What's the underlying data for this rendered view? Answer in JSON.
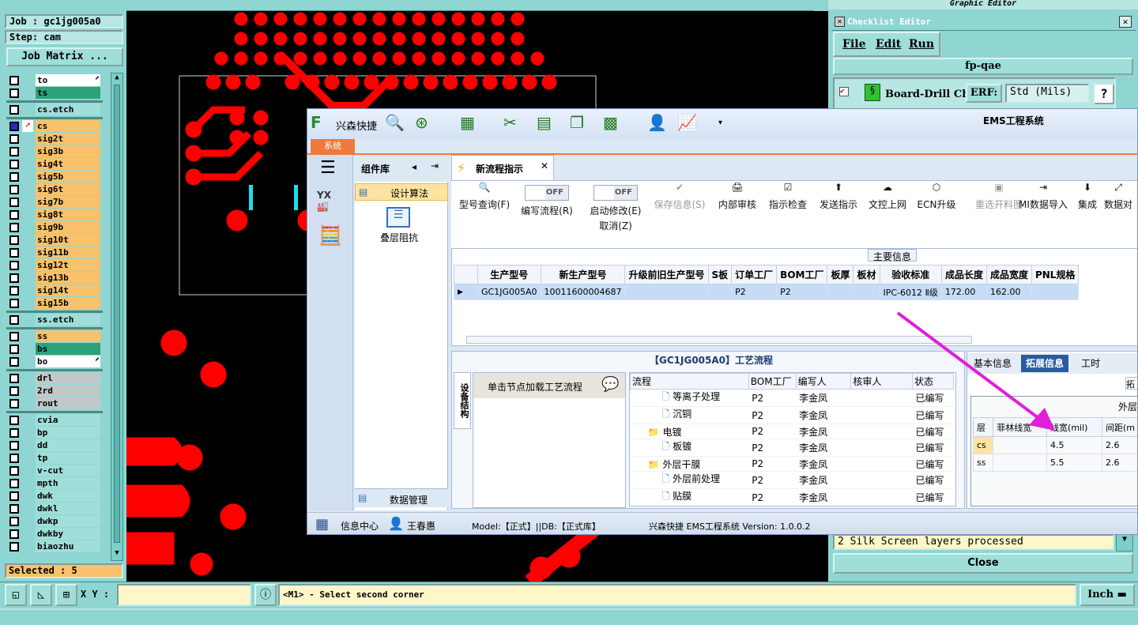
{
  "left_panel": {
    "job": "Job : gc1jg005a0",
    "step": "Step: cam",
    "job_matrix": "Job Matrix ...",
    "selected": "Selected : 5",
    "layers": [
      {
        "name": "to",
        "color": "#ffffff",
        "flag": "⬈"
      },
      {
        "name": "ts",
        "color": "#2aa27a"
      },
      {
        "name": "cs.etch",
        "color": "#9fded9"
      },
      {
        "name": "cs",
        "color": "#f7c26b",
        "active": true
      },
      {
        "name": "sig2t",
        "color": "#f7c26b"
      },
      {
        "name": "sig3b",
        "color": "#f7c26b"
      },
      {
        "name": "sig4t",
        "color": "#f7c26b"
      },
      {
        "name": "sig5b",
        "color": "#f7c26b"
      },
      {
        "name": "sig6t",
        "color": "#f7c26b"
      },
      {
        "name": "sig7b",
        "color": "#f7c26b"
      },
      {
        "name": "sig8t",
        "color": "#f7c26b"
      },
      {
        "name": "sig9b",
        "color": "#f7c26b"
      },
      {
        "name": "sig10t",
        "color": "#f7c26b"
      },
      {
        "name": "sig11b",
        "color": "#f7c26b"
      },
      {
        "name": "sig12t",
        "color": "#f7c26b"
      },
      {
        "name": "sig13b",
        "color": "#f7c26b"
      },
      {
        "name": "sig14t",
        "color": "#f7c26b"
      },
      {
        "name": "sig15b",
        "color": "#f7c26b"
      },
      {
        "name": "ss.etch",
        "color": "#9fded9"
      },
      {
        "name": "ss",
        "color": "#f7c26b"
      },
      {
        "name": "bs",
        "color": "#2aa27a"
      },
      {
        "name": "bo",
        "color": "#ffffff",
        "flag": "⬈"
      },
      {
        "name": "drl",
        "color": "#c0c8c8"
      },
      {
        "name": "2rd",
        "color": "#c0c8c8"
      },
      {
        "name": "rout",
        "color": "#c0c8c8"
      },
      {
        "name": "cvia",
        "color": "#9fded9"
      },
      {
        "name": "bp",
        "color": "#9fded9"
      },
      {
        "name": "dd",
        "color": "#9fded9"
      },
      {
        "name": "tp",
        "color": "#9fded9"
      },
      {
        "name": "v-cut",
        "color": "#9fded9"
      },
      {
        "name": "mpth",
        "color": "#9fded9"
      },
      {
        "name": "dwk",
        "color": "#9fded9"
      },
      {
        "name": "dwkl",
        "color": "#9fded9"
      },
      {
        "name": "dwkp",
        "color": "#9fded9"
      },
      {
        "name": "dwkby",
        "color": "#9fded9"
      },
      {
        "name": "biaozhu",
        "color": "#9fded9"
      }
    ]
  },
  "bottom": {
    "xy_label": "X Y :",
    "prompt": "<M1> - Select second corner",
    "unit": "Inch"
  },
  "graphic_editor": {
    "title": "Graphic Editor"
  },
  "checklist": {
    "title": "Checklist Editor",
    "menu": [
      "File",
      "Edit",
      "Run"
    ],
    "name": "fp-qae",
    "item": "Board-Drill Che",
    "erf": "ERF:",
    "erf_value": "Std (Mils)",
    "help": "?",
    "log": "2 Silk Screen layers processed",
    "close": "Close"
  },
  "ems": {
    "app_name": "兴森快捷",
    "title": "EMS工程系统",
    "sys_tab": "系统",
    "sidebar_title": "组件库",
    "group": "设计算法",
    "item": "叠层阻抗",
    "data_mgmt": "数据管理",
    "doc_tab": "新流程指示",
    "ribbon": [
      {
        "icon": "🔍",
        "label": "型号查询(F)"
      },
      {
        "icon": "",
        "label": "编写流程(R)",
        "toggle": "OFF"
      },
      {
        "icon": "",
        "label": "启动修改(E)",
        "label2": "取消(Z)",
        "toggle": "OFF"
      },
      {
        "icon": "✔",
        "label": "保存信息(S)",
        "disabled": true
      },
      {
        "icon": "🖨",
        "label": "内部审核"
      },
      {
        "icon": "☑",
        "label": "指示检查"
      },
      {
        "icon": "⬆",
        "label": "发送指示"
      },
      {
        "icon": "☁",
        "label": "文控上网"
      },
      {
        "icon": "⬡",
        "label": "ECN升级"
      },
      {
        "icon": "▣",
        "label": "重选开料图",
        "disabled": true
      },
      {
        "icon": "⇥",
        "label": "MI数据导入"
      },
      {
        "icon": "⬇",
        "label": "集成"
      },
      {
        "icon": "⤢",
        "label": "数据对"
      }
    ],
    "main_info": "主要信息",
    "grid_headers": [
      "生产型号",
      "新生产型号",
      "升级前旧生产型号",
      "S板",
      "订单工厂",
      "BOM工厂",
      "板厚",
      "板材",
      "验收标准",
      "成品长度",
      "成品宽度",
      "PNL规格"
    ],
    "grid_row": [
      "GC1JG005A0",
      "10011600004687",
      "",
      "",
      "P2",
      "P2",
      "",
      "",
      "IPC-6012 Ⅱ级",
      "172.00",
      "162.00",
      ""
    ],
    "flow_title": "【GC1JG005A0】工艺流程",
    "side_tab": "设备结构",
    "node_hint": "单击节点加载工艺流程",
    "tree_headers": [
      "流程",
      "BOM工厂",
      "编写人",
      "核审人",
      "状态"
    ],
    "tree_rows": [
      {
        "name": "等离子处理",
        "level": 2,
        "folder": false,
        "bom": "P2",
        "writer": "李金凤",
        "reviewer": "",
        "status": "已编写"
      },
      {
        "name": "沉铜",
        "level": 2,
        "folder": false,
        "bom": "P2",
        "writer": "李金凤",
        "reviewer": "",
        "status": "已编写"
      },
      {
        "name": "电镀",
        "level": 1,
        "folder": true,
        "bom": "P2",
        "writer": "李金凤",
        "reviewer": "",
        "status": "已编写"
      },
      {
        "name": "板镀",
        "level": 2,
        "folder": false,
        "bom": "P2",
        "writer": "李金凤",
        "reviewer": "",
        "status": "已编写"
      },
      {
        "name": "外层干膜",
        "level": 1,
        "folder": true,
        "bom": "P2",
        "writer": "李金凤",
        "reviewer": "",
        "status": "已编写"
      },
      {
        "name": "外层前处理",
        "level": 2,
        "folder": false,
        "bom": "P2",
        "writer": "李金凤",
        "reviewer": "",
        "status": "已编写"
      },
      {
        "name": "贴膜",
        "level": 2,
        "folder": false,
        "bom": "P2",
        "writer": "李金凤",
        "reviewer": "",
        "status": "已编写"
      }
    ],
    "right_tabs": [
      "基本信息",
      "拓展信息",
      "工时"
    ],
    "outer": "外层",
    "right_headers": [
      "层",
      "菲林线宽",
      "线宽(mil)",
      "间距(m"
    ],
    "right_rows": [
      [
        "cs",
        "",
        "4.5",
        "2.6"
      ],
      [
        "ss",
        "",
        "5.5",
        "2.6"
      ]
    ],
    "status": {
      "info": "信息中心",
      "user": "王春惠",
      "model": "Model:【正式】||DB:【正式库】",
      "version": "兴森快捷 EMS工程系统 Version: 1.0.0.2"
    }
  },
  "colors": {
    "genesis_bg": "#8fd6d2",
    "pcb_red": "#ff0000",
    "ems_blue": "#dce8f6",
    "arrow": "#e020d8"
  }
}
